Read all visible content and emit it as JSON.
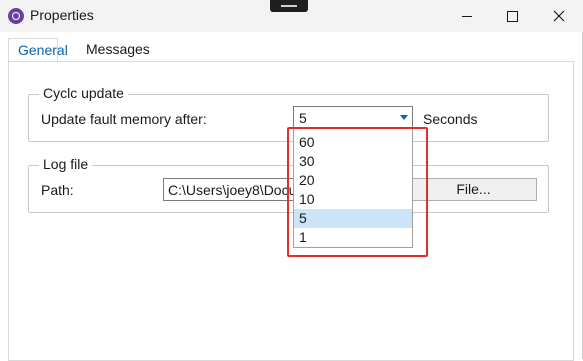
{
  "window": {
    "title": "Properties"
  },
  "tabs": [
    {
      "label": "General",
      "active": true
    },
    {
      "label": "Messages",
      "active": false
    }
  ],
  "cycle_update": {
    "legend": "Cyclc update",
    "field_label": "Update fault memory after:",
    "selected_value": "5",
    "unit_label": "Seconds",
    "options": [
      "60",
      "30",
      "20",
      "10",
      "5",
      "1"
    ]
  },
  "log_file": {
    "legend": "Log file",
    "path_label": "Path:",
    "path_value": "C:\\Users\\joey8\\Documents",
    "file_button_label": "File..."
  },
  "colors": {
    "accent": "#0a64ad",
    "selection": "#cce4f7",
    "annotation": "#e0302b",
    "app_icon": "#6b3fa0"
  }
}
